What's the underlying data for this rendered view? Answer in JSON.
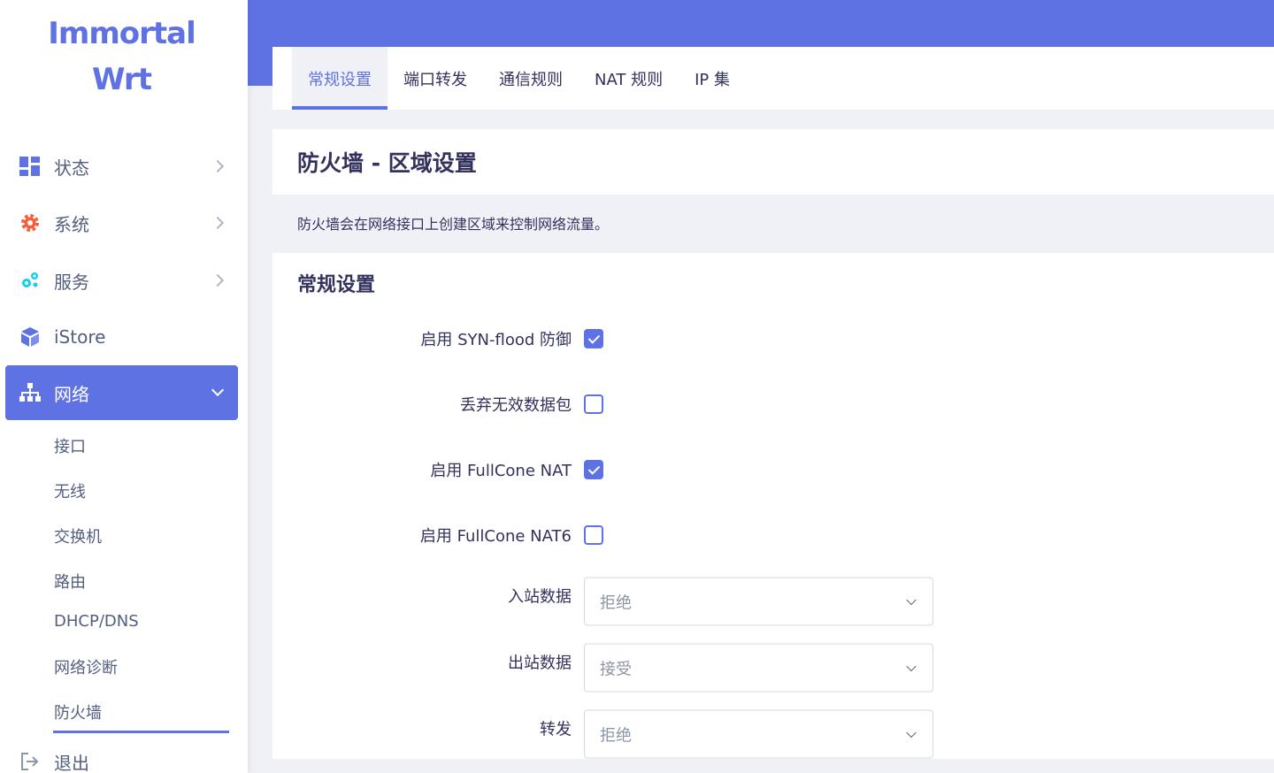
{
  "brand": {
    "line1": "Immortal",
    "line2": "Wrt"
  },
  "sidebar": {
    "items": [
      {
        "label": "状态",
        "icon": "dashboard-icon"
      },
      {
        "label": "系统",
        "icon": "gear-icon"
      },
      {
        "label": "服务",
        "icon": "gears-icon"
      },
      {
        "label": "iStore",
        "icon": "cube-icon"
      },
      {
        "label": "网络",
        "icon": "network-icon"
      },
      {
        "label": "退出",
        "icon": "logout-icon"
      }
    ],
    "network_sub": [
      "接口",
      "无线",
      "交换机",
      "路由",
      "DHCP/DNS",
      "网络诊断",
      "防火墙"
    ]
  },
  "tabs": [
    "常规设置",
    "端口转发",
    "通信规则",
    "NAT 规则",
    "IP 集"
  ],
  "page": {
    "title": "防火墙 - 区域设置",
    "description": "防火墙会在网络接口上创建区域来控制网络流量。",
    "section_title": "常规设置"
  },
  "settings": {
    "syn_flood": {
      "label": "启用 SYN-flood 防御",
      "checked": true
    },
    "drop_invalid": {
      "label": "丢弃无效数据包",
      "checked": false
    },
    "fullcone_nat": {
      "label": "启用 FullCone NAT",
      "checked": true
    },
    "fullcone_nat6": {
      "label": "启用 FullCone NAT6",
      "checked": false
    },
    "input": {
      "label": "入站数据",
      "value": "拒绝"
    },
    "output": {
      "label": "出站数据",
      "value": "接受"
    },
    "forward": {
      "label": "转发",
      "value": "拒绝"
    }
  },
  "colors": {
    "accent": "#5e72e4",
    "system_icon": "#f5603a",
    "services_icon": "#11cdef"
  }
}
